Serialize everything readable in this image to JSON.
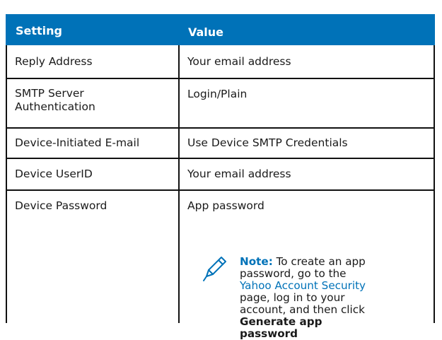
{
  "table": {
    "headers": [
      "Setting",
      "Value"
    ],
    "rows": [
      {
        "setting": "Reply Address",
        "value": "Your email address"
      },
      {
        "setting": "SMTP Server Authentication",
        "setting_line1": "SMTP Server",
        "setting_line2": "Authentication",
        "value": "Login/Plain"
      },
      {
        "setting": "Device-Initiated E-mail",
        "value": "Use Device SMTP Credentials"
      },
      {
        "setting": "Device UserID",
        "value": "Your email address"
      },
      {
        "setting": "Device Password",
        "value": "App password"
      }
    ]
  },
  "note": {
    "label": "Note:",
    "text_before_link": "To create an app password, go to the",
    "link_text": "Yahoo Account Security",
    "text_after_link": "page, log in to your account, and then click",
    "bold_text": "Generate app password",
    "icon": "pencil-icon"
  },
  "colors": {
    "header_bg": "#0072b8",
    "accent": "#0072b8"
  }
}
